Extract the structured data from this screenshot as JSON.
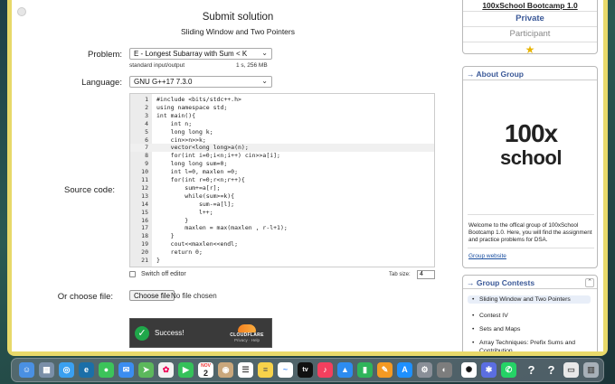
{
  "main": {
    "title": "Submit solution",
    "subtitle": "Sliding Window and Two Pointers",
    "problem_label": "Problem:",
    "problem_value": "E - Longest Subarray with Sum < K",
    "io_text": "standard input/output",
    "limits_text": "1 s, 256 MB",
    "language_label": "Language:",
    "language_value": "GNU G++17 7.3.0",
    "source_label": "Source code:",
    "code_lines": [
      {
        "n": "1",
        "text": "#include <bits/stdc++.h>"
      },
      {
        "n": "2",
        "text": "using namespace std;"
      },
      {
        "n": "3",
        "text": "int main(){"
      },
      {
        "n": "4",
        "text": "    int n;"
      },
      {
        "n": "5",
        "text": "    long long k;"
      },
      {
        "n": "6",
        "text": "    cin>>n>>k;"
      },
      {
        "n": "7",
        "text": "    vector<long long>a(n);"
      },
      {
        "n": "8",
        "text": "    for(int i=0;i<n;i++) cin>>a[i];"
      },
      {
        "n": "9",
        "text": "    long long sum=0;"
      },
      {
        "n": "10",
        "text": "    int l=0, maxlen =0;"
      },
      {
        "n": "11",
        "text": "    for(int r=0;r<n;r++){"
      },
      {
        "n": "12",
        "text": "        sum+=a[r];"
      },
      {
        "n": "13",
        "text": "        while(sum>=k){"
      },
      {
        "n": "14",
        "text": "            sum-=a[l];"
      },
      {
        "n": "15",
        "text": "            l++;"
      },
      {
        "n": "16",
        "text": "        }"
      },
      {
        "n": "17",
        "text": "        maxlen = max(maxlen , r-l+1);"
      },
      {
        "n": "18",
        "text": "    }"
      },
      {
        "n": "19",
        "text": "    cout<<maxlen<<endl;"
      },
      {
        "n": "20",
        "text": "    return 0;"
      },
      {
        "n": "21",
        "text": "}"
      }
    ],
    "switch_editor_label": "Switch off editor",
    "tab_size_label": "Tab size:",
    "tab_size_value": "4",
    "file_label": "Or choose file:",
    "choose_file_label": "Choose file",
    "no_file_text": "No file chosen",
    "captcha_status": "Success!",
    "captcha_brand": "CLOUDFLARE",
    "captcha_links": "Privacy · Help"
  },
  "sidebar": {
    "group_title": "100xSchool Bootcamp 1.0",
    "visibility": "Private",
    "role": "Participant",
    "about_header": "→ About Group",
    "logo_line1": "100x",
    "logo_line2": "school",
    "about_text": "Welcome to the offical group of 100xSchool Bootcamp 1.0. Here, you will find the assignment and practice problems for DSA.",
    "group_link": "Group website",
    "contests_header": "→ Group Contests",
    "contests": [
      "Sliding Window and Two Pointers",
      "Contest IV",
      "Sets and Maps",
      "Array Techniques: Prefix Sums and Contribution"
    ]
  },
  "dock": {
    "icons": [
      "finder-icon",
      "launchpad-icon",
      "safari-icon",
      "edge-icon",
      "messages-icon",
      "mail-icon",
      "maps-icon",
      "photos-icon",
      "facetime-icon",
      "calendar-icon",
      "contacts-icon",
      "reminders-icon",
      "notes-icon",
      "freeform-icon",
      "tv-icon",
      "music-icon",
      "keynote-icon",
      "numbers-icon",
      "pages-icon",
      "appstore-icon",
      "settings-icon",
      "chatgpt-icon",
      "claude-icon",
      "whatsapp-icon",
      "help-icon",
      "help-icon-2",
      "preview-icon",
      "trash-icon"
    ],
    "calendar_month": "NOV",
    "calendar_day": "2"
  },
  "colors": {
    "window_frame": "#e8d96a",
    "link_blue": "#3b5998",
    "success_green": "#1fa74a",
    "cloudflare_orange": "#f48120"
  }
}
